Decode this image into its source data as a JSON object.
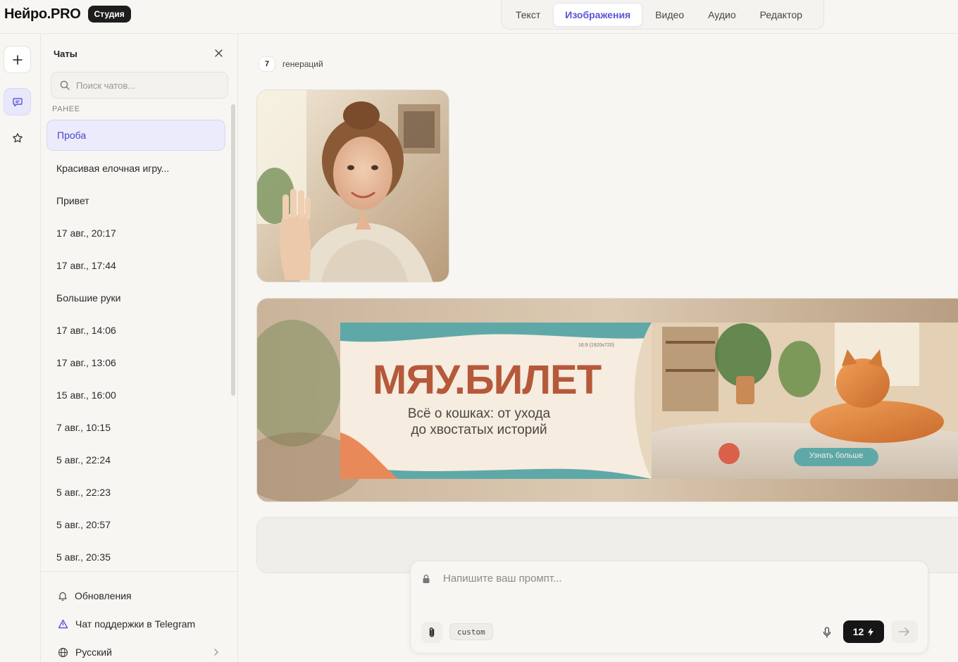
{
  "brand": {
    "name": "Нейро.PRO",
    "badge": "Студия"
  },
  "modes": [
    "Текст",
    "Изображения",
    "Видео",
    "Аудио",
    "Редактор"
  ],
  "active_mode": "Изображения",
  "chats": {
    "title": "Чаты",
    "search_placeholder": "Поиск чатов...",
    "section_label": "РАНЕЕ",
    "items": [
      {
        "label": "Проба",
        "active": true
      },
      {
        "label": "Красивая елочная игру..."
      },
      {
        "label": "Привет"
      },
      {
        "label": "17 авг., 20:17"
      },
      {
        "label": "17 авг., 17:44"
      },
      {
        "label": "Большие руки"
      },
      {
        "label": "17 авг., 14:06"
      },
      {
        "label": "17 авг., 13:06"
      },
      {
        "label": "15 авг., 16:00"
      },
      {
        "label": "7 авг., 10:15"
      },
      {
        "label": "5 авг., 22:24"
      },
      {
        "label": "5 авг., 22:23"
      },
      {
        "label": "5 авг., 20:57"
      },
      {
        "label": "5 авг., 20:35"
      }
    ],
    "footer": {
      "updates": "Обновления",
      "support": "Чат поддержки в Telegram",
      "language": "Русский"
    }
  },
  "main": {
    "generation_count": "7",
    "generation_label": "генераций",
    "banner": {
      "size_caption": "16:9 (1920x720)",
      "title": "МЯУ.БИЛЕТ",
      "subtitle_line1": "Всё о кошках: от ухода",
      "subtitle_line2": "до хвостатых историй",
      "cta": "Узнать больше"
    },
    "composer": {
      "placeholder": "Напишите ваш промпт...",
      "style_chip": "custom",
      "credits": "12"
    }
  },
  "colors": {
    "accent": "#5b55d6",
    "banner_teal": "#5fa8a8",
    "banner_title": "#b5593a"
  }
}
